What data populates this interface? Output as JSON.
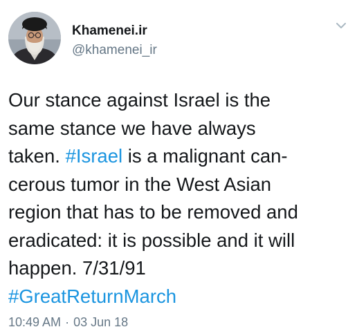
{
  "author": {
    "display_name": "Khamenei.ir",
    "handle": "@khamenei_ir",
    "avatar_icon": "profile-photo"
  },
  "menu": {
    "caret_icon": "chevron-down-icon"
  },
  "tweet": {
    "lines": [
      [
        {
          "text": "Our stance against Israel is the",
          "type": "text"
        }
      ],
      [
        {
          "text": "same stance we have always",
          "type": "text"
        }
      ],
      [
        {
          "text": "taken. ",
          "type": "text"
        },
        {
          "text": "#Israel",
          "type": "hashtag"
        },
        {
          "text": " is a malignant can-",
          "type": "text"
        }
      ],
      [
        {
          "text": "cerous tumor in the West Asian",
          "type": "text"
        }
      ],
      [
        {
          "text": "region that has to be removed and",
          "type": "text"
        }
      ],
      [
        {
          "text": "eradicated: it is possible and it will",
          "type": "text"
        }
      ],
      [
        {
          "text": "happen. 7/31/91",
          "type": "text"
        }
      ],
      [
        {
          "text": "#GreatReturnMarch",
          "type": "hashtag"
        }
      ]
    ]
  },
  "meta": {
    "time": "10:49 AM",
    "separator": "·",
    "date": "03 Jun 18"
  },
  "colors": {
    "link": "#1b95e0",
    "secondary_text": "#657786",
    "primary_text": "#14171a"
  }
}
